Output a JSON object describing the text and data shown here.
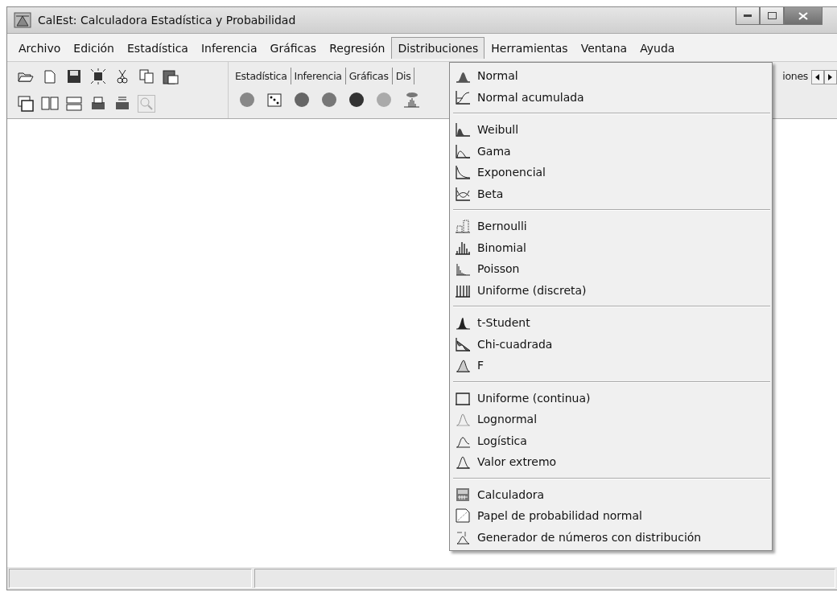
{
  "window": {
    "title": "CalEst: Calculadora Estadística y Probabilidad"
  },
  "menu_bar": [
    {
      "label": "Archivo",
      "selected": false
    },
    {
      "label": "Edición",
      "selected": false
    },
    {
      "label": "Estadística",
      "selected": false
    },
    {
      "label": "Inferencia",
      "selected": false
    },
    {
      "label": "Gráficas",
      "selected": false
    },
    {
      "label": "Regresión",
      "selected": false
    },
    {
      "label": "Distribuciones",
      "selected": true
    },
    {
      "label": "Herramientas",
      "selected": false
    },
    {
      "label": "Ventana",
      "selected": false
    },
    {
      "label": "Ayuda",
      "selected": false
    }
  ],
  "toolbar_tabs": [
    "Estadística",
    "Inferencia",
    "Gráficas",
    "Dis"
  ],
  "toolbar_tabs_right": [
    "iones"
  ],
  "dropdown": {
    "groups": [
      [
        "Normal",
        "Normal acumulada"
      ],
      [
        "Weibull",
        "Gama",
        "Exponencial",
        "Beta"
      ],
      [
        "Bernoulli",
        "Binomial",
        "Poisson",
        "Uniforme (discreta)"
      ],
      [
        "t-Student",
        "Chi-cuadrada",
        "F"
      ],
      [
        "Uniforme (continua)",
        "Lognormal",
        "Logística",
        "Valor extremo"
      ],
      [
        "Calculadora",
        "Papel de probabilidad normal",
        "Generador de números con distribución"
      ]
    ]
  }
}
